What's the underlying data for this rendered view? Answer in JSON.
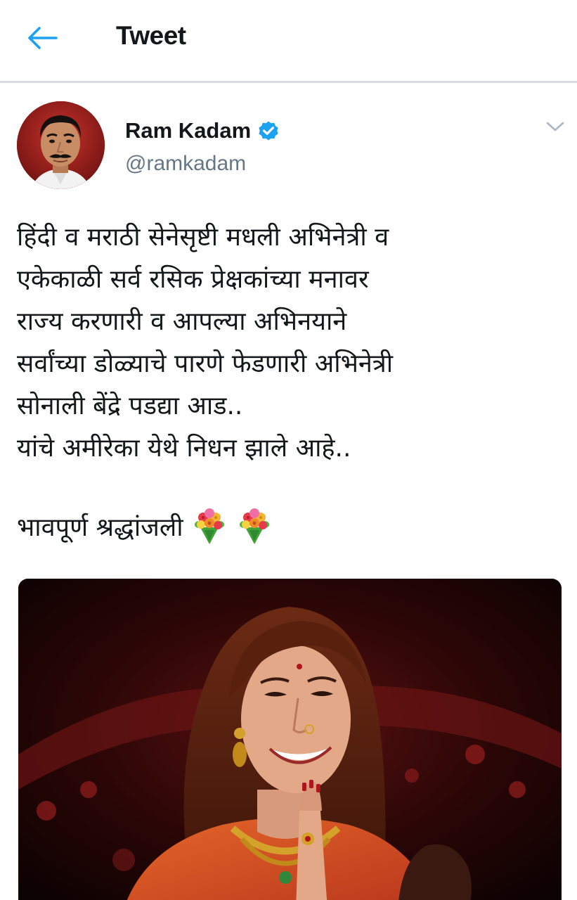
{
  "header": {
    "title": "Tweet",
    "back_icon": "arrow-left-icon",
    "accent_color": "#1da1f2"
  },
  "tweet": {
    "author": {
      "name": "Ram Kadam",
      "handle": "@ramkadam",
      "verified": true,
      "verified_icon": "verified-badge-icon"
    },
    "caret_icon": "chevron-down-icon",
    "text_lines": [
      "हिंदी व मराठी सेनेसृष्टी मधली अभिनेत्री व",
      "एकेकाळी सर्व रसिक प्रेक्षकांच्या मनावर",
      "राज्य करणारी व आपल्या अभिनयाने",
      "सर्वांच्या डोळ्याचे पारणे फेडणारी अभिनेत्री",
      "सोनाली बेंद्रे पडद्या आड..",
      "यांचे अमीरेका येथे निधन झाले आहे.."
    ],
    "tribute": "भावपूर्ण श्रद्धांजली",
    "tribute_emoji_icon": "bouquet-icon",
    "media": {
      "type": "photo",
      "description_icon": "woman-namaste-photo"
    }
  }
}
